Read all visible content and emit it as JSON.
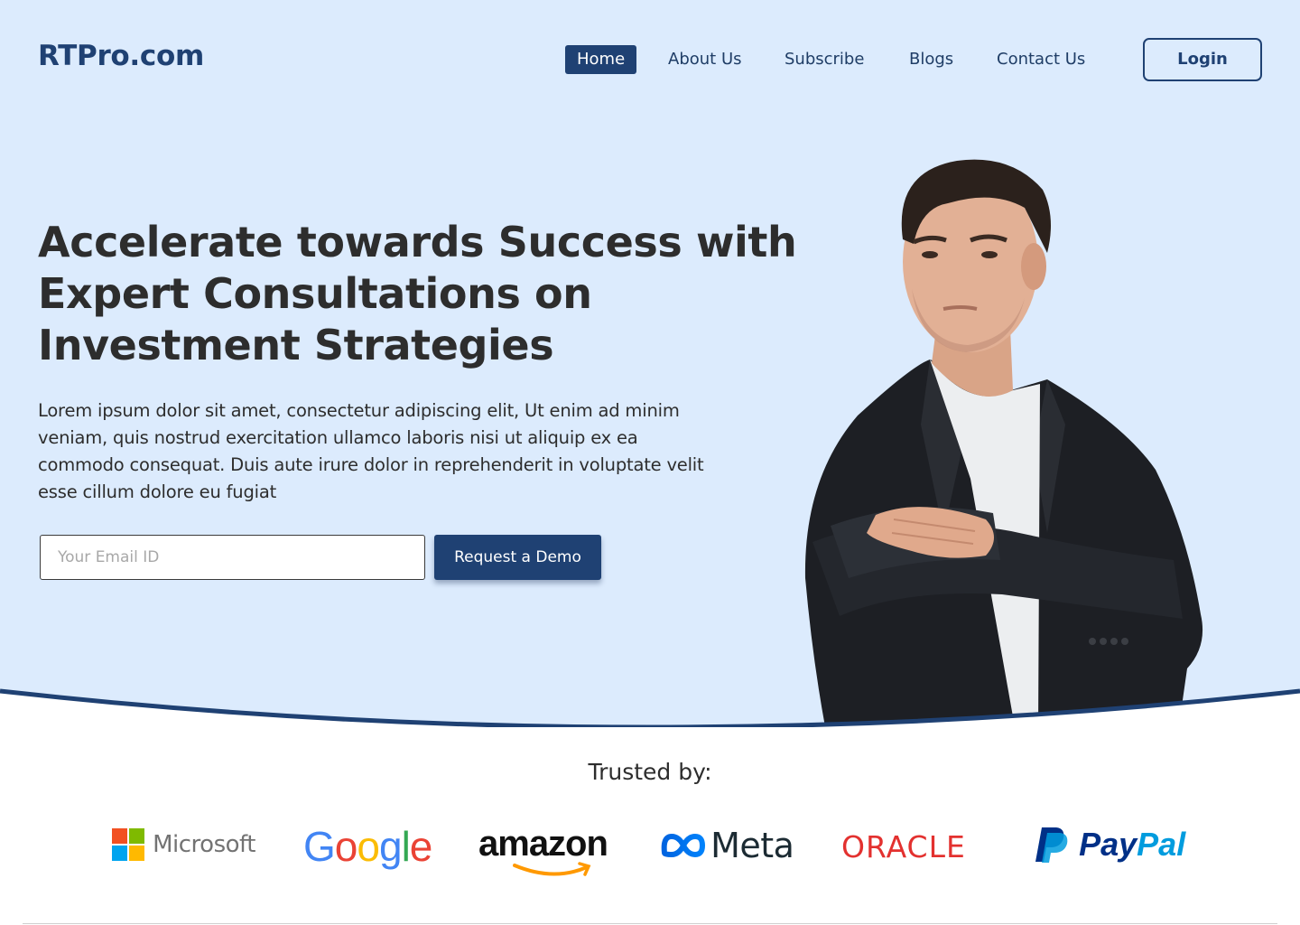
{
  "header": {
    "logo": "RTPro.com",
    "nav": [
      {
        "label": "Home",
        "active": true
      },
      {
        "label": "About Us",
        "active": false
      },
      {
        "label": "Subscribe",
        "active": false
      },
      {
        "label": "Blogs",
        "active": false
      },
      {
        "label": "Contact Us",
        "active": false
      }
    ],
    "login_label": "Login"
  },
  "hero": {
    "headline_lines": [
      "Accelerate towards Success with",
      "Expert Consultations on",
      "Investment Strategies"
    ],
    "description": "Lorem ipsum dolor sit amet, consectetur adipiscing elit, Ut enim ad minim veniam, quis nostrud exercitation ullamco laboris nisi ut aliquip ex ea commodo consequat. Duis aute irure dolor in reprehenderit in voluptate velit esse cillum dolore eu fugiat",
    "email_placeholder": "Your Email ID",
    "email_value": "",
    "cta_label": "Request a Demo"
  },
  "trusted": {
    "label": "Trusted by:",
    "brands": [
      "Microsoft",
      "Google",
      "amazon",
      "Meta",
      "ORACLE",
      "PayPal"
    ]
  },
  "colors": {
    "primary": "#1f4173",
    "hero_bg": "#dcebfd",
    "text": "#2d2d2d"
  }
}
